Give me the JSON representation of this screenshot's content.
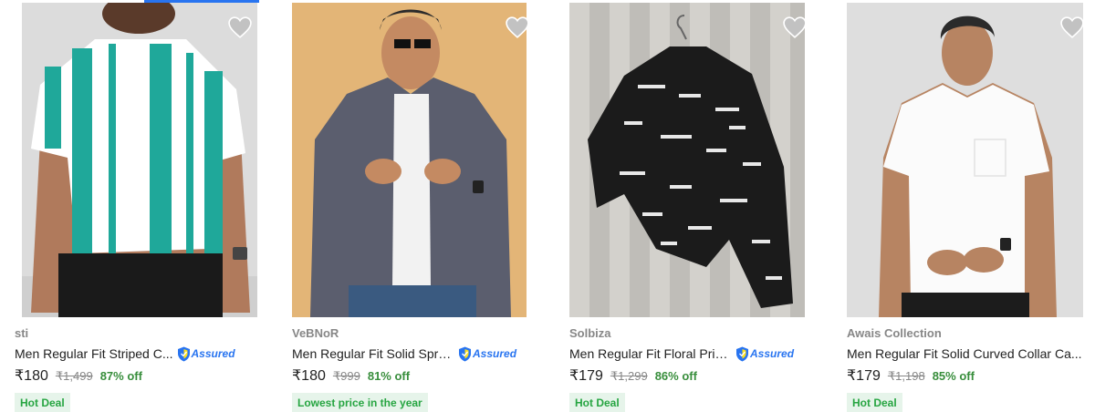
{
  "products": [
    {
      "brand": "sti",
      "title": "Men Regular Fit Striped C...",
      "assured_label": "Assured",
      "price": "₹180",
      "mrp": "₹1,499",
      "discount": "87% off",
      "badge": "Hot Deal",
      "image_icon": "striped-shirt-photo"
    },
    {
      "brand": "VeBNoR",
      "title": "Men Regular Fit Solid Spre...",
      "assured_label": "Assured",
      "price": "₹180",
      "mrp": "₹999",
      "discount": "81% off",
      "badge": "Lowest price in the year",
      "image_icon": "grey-shirt-photo"
    },
    {
      "brand": "Solbiza",
      "title": "Men Regular Fit Floral Prin...",
      "assured_label": "Assured",
      "price": "₹179",
      "mrp": "₹1,299",
      "discount": "86% off",
      "badge": "Hot Deal",
      "image_icon": "black-printed-shirt-photo"
    },
    {
      "brand": "Awais Collection",
      "title": "Men Regular Fit Solid Curved Collar Ca...",
      "assured_label": "",
      "price": "₹179",
      "mrp": "₹1,198",
      "discount": "85% off",
      "badge": "Hot Deal",
      "image_icon": "white-shirt-photo"
    }
  ],
  "colors": {
    "accent": "#2874f0",
    "discount_green": "#388e3c",
    "badge_bg": "#e6f4ea",
    "badge_text": "#26a541",
    "muted": "#878787",
    "wishlist": "#c2c2c2"
  }
}
